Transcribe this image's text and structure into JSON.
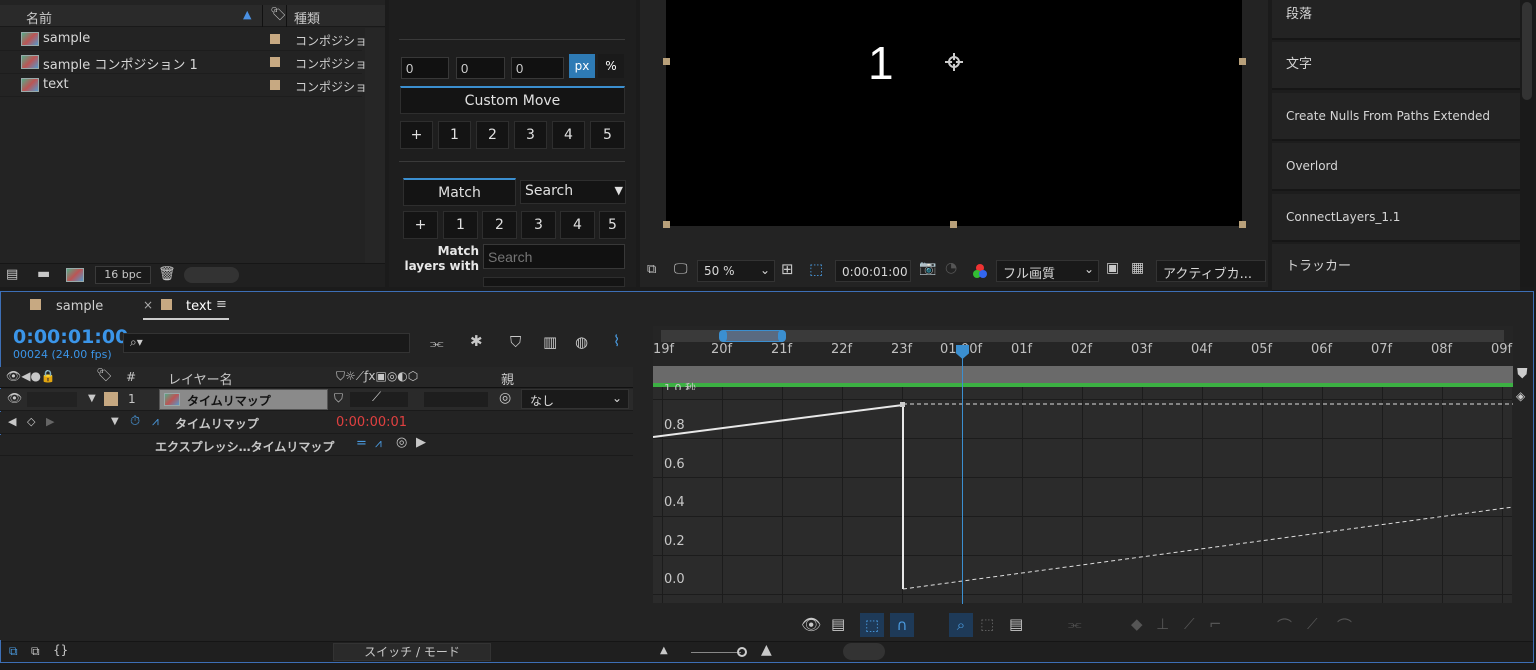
{
  "project": {
    "col_name": "名前",
    "col_type": "種類",
    "items": [
      {
        "name": "sample",
        "type": "コンポジショ"
      },
      {
        "name": "sample コンポジション 1",
        "type": "コンポジショ"
      },
      {
        "name": "text",
        "type": "コンポジショ"
      }
    ],
    "bpc": "16 bpc"
  },
  "custom_move": {
    "inputs": [
      "0",
      "0",
      "0"
    ],
    "unit_px": "px",
    "unit_pct": "%",
    "title": "Custom Move",
    "row_buttons": [
      "+",
      "1",
      "2",
      "3",
      "4",
      "5"
    ],
    "tab_match": "Match",
    "tab_search": "Search",
    "match_buttons": [
      "+",
      "1",
      "2",
      "3",
      "4",
      "5"
    ],
    "match_layers_label": "Match layers with",
    "search_placeholder": "Search"
  },
  "viewer": {
    "content_text": "1",
    "zoom": "50 %",
    "timecode": "0:00:01:00",
    "quality": "フル画質",
    "camera": "アクティブカ..."
  },
  "right_panel": {
    "items": [
      "段落",
      "文字",
      "Create Nulls From Paths Extended",
      "Overlord",
      "ConnectLayers_1.1",
      "トラッカー"
    ]
  },
  "timeline": {
    "tabs": [
      "sample",
      "text"
    ],
    "timecode": "0:00:01:00",
    "frames": "00024 (24.00 fps)",
    "search_placeholder": "",
    "col_num": "#",
    "col_layer_name": "レイヤー名",
    "col_parent": "親",
    "layer": {
      "num": "1",
      "name": "タイムリマップ",
      "parent": "なし"
    },
    "property": {
      "name": "タイムリマップ",
      "value": "0:00:00:01"
    },
    "expression_label": "エクスプレッシ…タイムリマップ",
    "switch_mode": "スイッチ / モード",
    "ruler": [
      "19f",
      "20f",
      "21f",
      "22f",
      "23f",
      "01:00f",
      "01f",
      "02f",
      "03f",
      "04f",
      "05f",
      "06f",
      "07f",
      "08f",
      "09f"
    ],
    "y_labels": [
      "1.0 秒",
      "0.8",
      "0.6",
      "0.4",
      "0.2",
      "0.0"
    ]
  }
}
